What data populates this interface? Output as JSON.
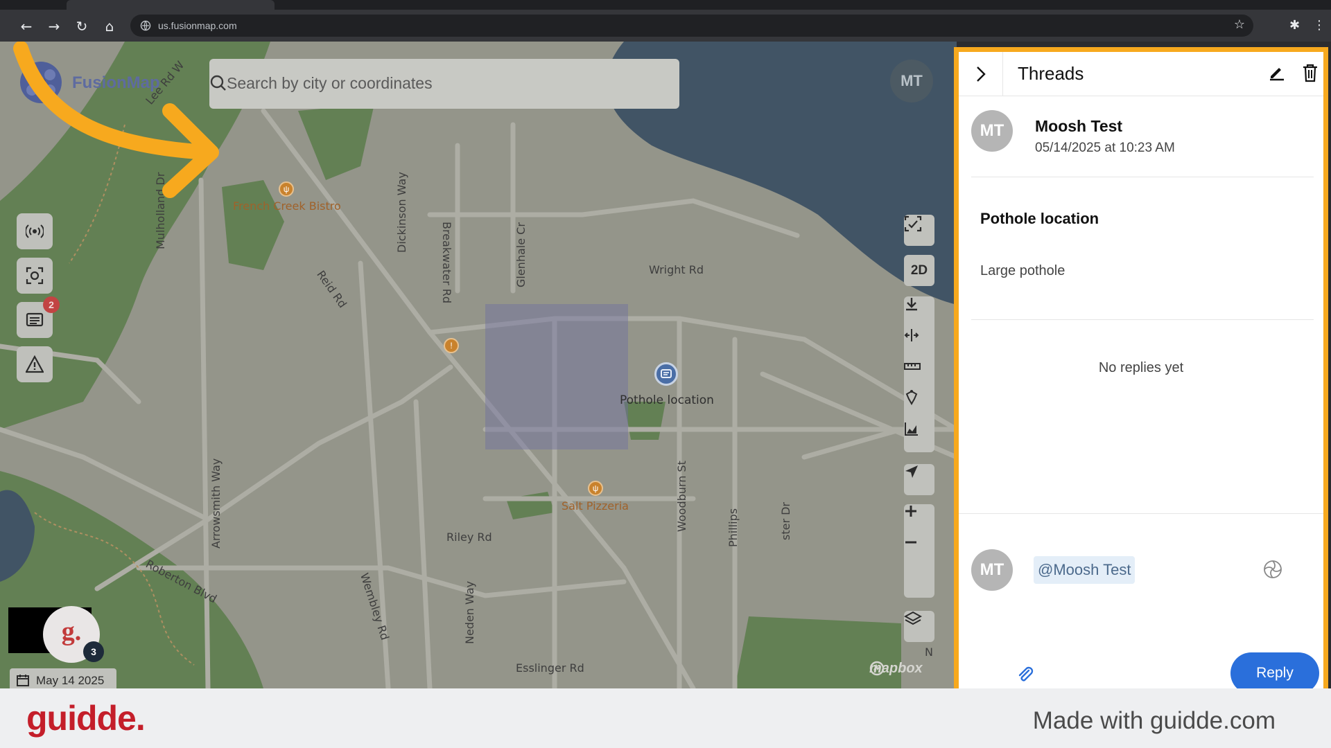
{
  "browser": {
    "url": "us.fusionmap.com",
    "nav_icons": [
      "back-icon",
      "forward-icon",
      "reload-icon",
      "home-icon"
    ],
    "right_icons": [
      "star-icon",
      "extensions-icon",
      "menu-icon"
    ]
  },
  "app": {
    "logo_text": "FusionMap",
    "search_placeholder": "Search by city or coordinates",
    "user_initials": "MT",
    "left_tools": [
      {
        "icon": "broadcast-icon"
      },
      {
        "icon": "focus-icon"
      },
      {
        "icon": "comments-icon",
        "badge": "2"
      },
      {
        "icon": "warning-icon"
      }
    ],
    "right_tools": {
      "top": "ai-capture-icon",
      "mode_label": "2D",
      "group": [
        "download-icon",
        "split-icon",
        "ruler-icon",
        "draw-icon",
        "chart-icon"
      ],
      "locate": "locate-icon",
      "zoom": [
        "zoom-in-icon",
        "zoom-out-icon"
      ],
      "layers": "layers-icon"
    },
    "map_labels": {
      "road_lee": "Lee Rd W",
      "restaurant1": "French Creek Bistro",
      "mulholland": "Mulholland Dr",
      "dickinson": "Dickinson Way",
      "breakwater": "Breakwater Rd",
      "glenhale": "Glenhale Cr",
      "reid": "Reid Rd",
      "wright": "Wright Rd",
      "arrowsmith": "Arrowsmith Way",
      "roberton": "Roberton Blvd",
      "wembley": "Wembley Rd",
      "riley": "Riley Rd",
      "restaurant2": "Salt Pizzeria",
      "woodburn": "Woodburn St",
      "phillips": "Phillips",
      "foster": "ster Dr",
      "neden": "Neden Way",
      "esslinger": "Esslinger Rd",
      "pothole": "Pothole location",
      "north_fragment": "N"
    },
    "date": "May 14 2025",
    "guidde_avatar": "g.",
    "guidde_count": "3",
    "attribution": "mapbox"
  },
  "thread_panel": {
    "title": "Threads",
    "author_initials": "MT",
    "author_name": "Moosh Test",
    "timestamp": "05/14/2025 at 10:23 AM",
    "thread_title": "Pothole location",
    "thread_body": "Large pothole",
    "empty_state": "No replies yet",
    "reply_initials": "MT",
    "mention": "@Moosh Test",
    "reply_label": "Reply",
    "accent_color": "#f7a91e",
    "reply_color": "#2a6fdb"
  },
  "footer": {
    "brand": "guidde.",
    "tagline": "Made with guidde.com"
  }
}
